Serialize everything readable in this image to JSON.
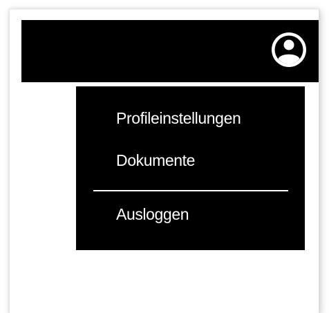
{
  "header": {
    "avatar_icon": "user-circle-icon"
  },
  "menu": {
    "items": [
      {
        "label": "Profileinstellungen"
      },
      {
        "label": "Dokumente"
      },
      {
        "label": "Ausloggen"
      }
    ]
  },
  "colors": {
    "bar_background": "#000000",
    "menu_background": "#000000",
    "menu_text": "#ffffff",
    "page_background": "#ffffff"
  }
}
